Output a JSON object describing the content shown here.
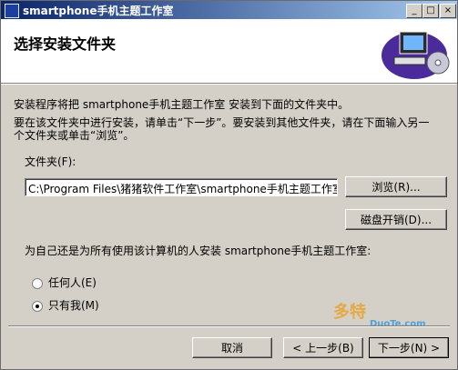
{
  "window": {
    "title": "smartphone手机主题工作室"
  },
  "titlebar_buttons": {
    "minimize": "_",
    "maximize": "□",
    "close": "×"
  },
  "header": {
    "title": "选择安装文件夹"
  },
  "body": {
    "line1": "安装程序将把 smartphone手机主题工作室 安装到下面的文件夹中。",
    "line2": "要在该文件夹中进行安装，请单击“下一步”。要安装到其他文件夹，请在下面输入另一",
    "line3": "个文件夹或单击“浏览”。",
    "folder_label": "文件夹(F):",
    "folder_value": "C:\\Program Files\\猪猪软件工作室\\smartphone手机主题工作室",
    "browse_label": "浏览(R)...",
    "disk_cost_label": "磁盘开销(D)...",
    "install_for_question": "为自己还是为所有使用该计算机的人安装 smartphone手机主题工作室:",
    "options": [
      {
        "label": "任何人(E)",
        "checked": false
      },
      {
        "label": "只有我(M)",
        "checked": true
      }
    ]
  },
  "footer": {
    "cancel_label": "取消",
    "back_label": "< 上一步(B)",
    "next_label": "下一步(N) >"
  },
  "watermark": {
    "text": "多特",
    "subtext": "DuoTe.com"
  }
}
